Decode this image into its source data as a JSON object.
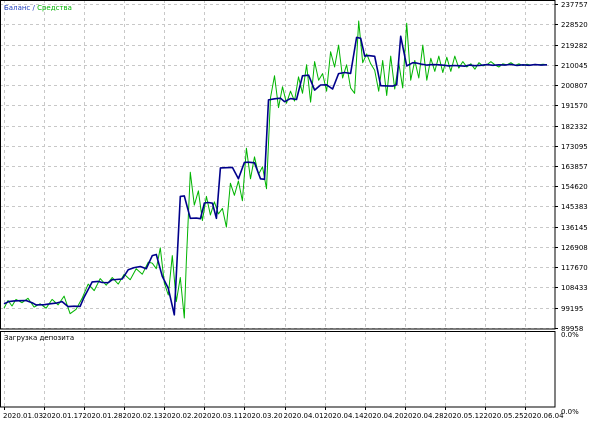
{
  "legend": {
    "balance_label": "Баланс",
    "separator": " / ",
    "equity_label": "Средства"
  },
  "subpanel": {
    "title": "Загрузка депозита",
    "top_label": "0.0%",
    "bottom_label": "0.0%"
  },
  "colors": {
    "balance": "#00008b",
    "equity": "#00b400",
    "grid": "#c8c8c8",
    "frame": "#000000",
    "background": "#ffffff"
  },
  "chart_data": {
    "type": "line",
    "title": "",
    "xlabel": "",
    "ylabel": "",
    "ylim": [
      89958,
      237757
    ],
    "y_ticks": [
      "237757",
      "228520",
      "219282",
      "210045",
      "200807",
      "191570",
      "182332",
      "173095",
      "163857",
      "154620",
      "145383",
      "136145",
      "126908",
      "117670",
      "108433",
      "99195",
      "89958"
    ],
    "x_ticks": [
      "2020.01.03",
      "2020.01.17",
      "2020.01.28",
      "2020.02.13",
      "2020.02.20",
      "2020.03.11",
      "2020.03.20",
      "2020.04.01",
      "2020.04.14",
      "2020.04.20",
      "2020.04.28",
      "2020.05.12",
      "2020.05.25",
      "2020.06.04"
    ],
    "x_range": [
      0,
      13.6
    ],
    "grid": true,
    "legend_position": "top-left",
    "series": [
      {
        "name": "Баланс",
        "x": [
          0.0,
          0.12,
          0.25,
          0.4,
          0.55,
          0.7,
          0.8,
          1.0,
          1.15,
          1.3,
          1.45,
          1.6,
          1.75,
          1.9,
          2.0,
          2.2,
          2.35,
          2.45,
          2.6,
          2.7,
          2.8,
          2.95,
          3.1,
          3.25,
          3.4,
          3.55,
          3.7,
          3.8,
          3.95,
          4.1,
          4.25,
          4.4,
          4.5,
          4.65,
          4.8,
          4.9,
          5.0,
          5.1,
          5.2,
          5.3,
          5.4,
          5.55,
          5.7,
          5.85,
          6.0,
          6.1,
          6.25,
          6.4,
          6.5,
          6.6,
          6.75,
          6.9,
          7.0,
          7.15,
          7.3,
          7.45,
          7.6,
          7.75,
          7.9,
          8.05,
          8.2,
          8.35,
          8.5,
          8.65,
          8.8,
          8.9,
          9.0,
          9.1,
          9.25,
          9.4,
          9.55,
          9.7,
          9.8,
          9.9,
          10.05,
          10.2,
          10.3,
          10.4,
          10.55,
          10.7,
          10.85,
          11.0,
          11.1,
          11.2,
          11.35,
          11.5,
          11.6,
          11.75,
          11.9,
          12.05,
          12.2,
          12.35,
          12.5,
          12.65,
          12.8,
          12.95,
          13.1,
          13.25,
          13.4,
          13.55
        ],
        "values": [
          101000,
          102000,
          102300,
          102400,
          102500,
          101500,
          100500,
          100600,
          101000,
          101300,
          102000,
          99700,
          99900,
          99800,
          104000,
          111000,
          111200,
          110700,
          110600,
          112000,
          112100,
          112300,
          116500,
          117500,
          118000,
          117000,
          123000,
          123500,
          113500,
          108000,
          96000,
          150000,
          150200,
          140000,
          140100,
          139800,
          147000,
          147200,
          146900,
          140000,
          163000,
          163100,
          163200,
          158000,
          165500,
          165600,
          165300,
          158000,
          157800,
          194000,
          194500,
          194800,
          193200,
          194600,
          194200,
          205000,
          205300,
          198500,
          200800,
          200900,
          199000,
          206000,
          206500,
          206100,
          222500,
          222100,
          214000,
          214200,
          213900,
          200500,
          200400,
          200300,
          201000,
          223000,
          209500,
          211000,
          210800,
          210400,
          209900,
          210100,
          210000,
          209800,
          209500,
          209700,
          209600,
          209400,
          209900,
          209600,
          209800,
          210100,
          209800,
          210000,
          209900,
          210200,
          209700,
          210000,
          209800,
          210100,
          209900,
          210000
        ]
      },
      {
        "name": "Средства",
        "x": [
          0.0,
          0.1,
          0.2,
          0.3,
          0.45,
          0.6,
          0.75,
          0.9,
          1.05,
          1.2,
          1.35,
          1.5,
          1.65,
          1.8,
          1.95,
          2.1,
          2.25,
          2.4,
          2.55,
          2.7,
          2.85,
          3.0,
          3.15,
          3.3,
          3.45,
          3.6,
          3.7,
          3.8,
          3.9,
          4.0,
          4.1,
          4.2,
          4.3,
          4.4,
          4.5,
          4.55,
          4.65,
          4.75,
          4.85,
          4.95,
          5.05,
          5.15,
          5.25,
          5.35,
          5.45,
          5.55,
          5.65,
          5.75,
          5.85,
          5.95,
          6.05,
          6.15,
          6.25,
          6.35,
          6.45,
          6.55,
          6.65,
          6.75,
          6.85,
          6.95,
          7.05,
          7.15,
          7.25,
          7.35,
          7.45,
          7.55,
          7.65,
          7.75,
          7.85,
          7.95,
          8.05,
          8.15,
          8.25,
          8.35,
          8.45,
          8.55,
          8.65,
          8.75,
          8.85,
          8.95,
          9.05,
          9.15,
          9.25,
          9.35,
          9.45,
          9.55,
          9.65,
          9.75,
          9.85,
          9.95,
          10.05,
          10.15,
          10.25,
          10.35,
          10.45,
          10.55,
          10.65,
          10.75,
          10.85,
          10.95,
          11.05,
          11.15,
          11.25,
          11.35,
          11.45,
          11.55,
          11.65,
          11.75,
          11.85,
          11.95,
          12.05,
          12.15,
          12.25,
          12.35,
          12.45,
          12.55,
          12.65,
          12.75,
          12.85,
          12.95,
          13.05,
          13.15,
          13.25,
          13.35,
          13.45,
          13.55
        ],
        "values": [
          99000,
          102500,
          100000,
          103000,
          101500,
          103500,
          99500,
          101000,
          99000,
          103000,
          100500,
          104500,
          96500,
          98500,
          103500,
          110000,
          107000,
          112500,
          109500,
          113000,
          110000,
          114500,
          112000,
          117000,
          114500,
          120000,
          119500,
          117000,
          126500,
          110500,
          105000,
          123000,
          102000,
          113000,
          94500,
          120000,
          161000,
          146000,
          152500,
          139000,
          150000,
          141500,
          147500,
          142000,
          144500,
          136000,
          156000,
          150500,
          157000,
          148000,
          172000,
          158000,
          168000,
          160000,
          163500,
          153500,
          195000,
          205000,
          190500,
          200000,
          192500,
          198000,
          193500,
          204500,
          197000,
          210000,
          193000,
          211500,
          203000,
          206000,
          198000,
          216000,
          209000,
          219000,
          204000,
          210000,
          199500,
          197000,
          230000,
          211000,
          215000,
          210500,
          207500,
          198000,
          212000,
          196000,
          214000,
          199000,
          211000,
          199500,
          229000,
          203000,
          212000,
          204000,
          219000,
          203000,
          213000,
          207000,
          214000,
          206500,
          213500,
          207000,
          214000,
          208500,
          211500,
          209000,
          210500,
          208000,
          211000,
          209500,
          210000,
          211500,
          210000,
          209000,
          210500,
          210000,
          211000,
          209800,
          210500,
          209700,
          210300,
          209900,
          210200,
          210000,
          210300,
          210000
        ]
      }
    ],
    "subpanel_ylim_labels": [
      "0.0%",
      "0.0%"
    ]
  }
}
